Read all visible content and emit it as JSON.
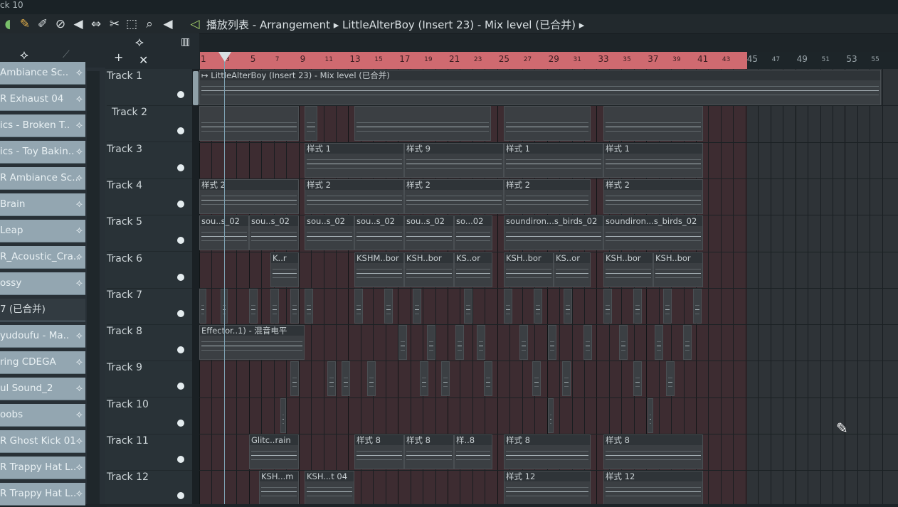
{
  "window": {
    "title_text": "播放列表 - Arrangement ▸ LittleAlterBoy (Insert 23) - Mix level (已合并) ▸",
    "corner_label": "ck 10"
  },
  "toolbar_icons": [
    "pencil-icon",
    "paint-icon",
    "mute-icon",
    "speaker-icon",
    "slip-icon",
    "slice-icon",
    "select-icon",
    "zoom-icon",
    "playback-icon"
  ],
  "browser_items": [
    {
      "label": "Ambiance Sc.."
    },
    {
      "label": "R Exhaust 04"
    },
    {
      "label": "ics - Broken T.."
    },
    {
      "label": "ics - Toy Bakin.."
    },
    {
      "label": "R Ambiance Sc.."
    },
    {
      "label": "Brain"
    },
    {
      "label": "Leap"
    },
    {
      "label": "R_Acoustic_Cra.."
    },
    {
      "label": "ossy"
    },
    {
      "label": "7 (已合并)"
    },
    {
      "label": "yudoufu - Ma.."
    },
    {
      "label": "ring CDEGA"
    },
    {
      "label": "ul Sound_2"
    },
    {
      "label": "oobs"
    },
    {
      "label": "R Ghost Kick 01"
    },
    {
      "label": "R Trappy Hat L.."
    },
    {
      "label": "R Trappy Hat L.."
    }
  ],
  "tracks": [
    "Track 1",
    "Track 2",
    "Track 3",
    "Track 4",
    "Track 5",
    "Track 6",
    "Track 7",
    "Track 8",
    "Track 9",
    "Track 10",
    "Track 11",
    "Track 12"
  ],
  "ruler_ticks": [
    "1",
    "3",
    "5",
    "7",
    "9",
    "11",
    "13",
    "15",
    "17",
    "19",
    "21",
    "23",
    "25",
    "27",
    "29",
    "31",
    "33",
    "35",
    "37",
    "39",
    "41",
    "43",
    "45",
    "47",
    "49",
    "51",
    "53",
    "55"
  ],
  "clips": {
    "t1_audio": "↦ LittleAlterBoy (Insert 23) - Mix level (已合并)",
    "t3_a": "样式 1",
    "t3_b": "样式 9",
    "t3_c": "样式 1",
    "t3_d": "样式 1",
    "t4_a": "样式 2",
    "t4_b": "样式 2",
    "t4_c": "样式 2",
    "t4_d": "样式 2",
    "t4_e": "样式 2",
    "t5_a": "sou..s_02",
    "t5_b": "sou..s_02",
    "t5_c": "sou..s_02",
    "t5_d": "sou..s_02",
    "t5_e": "sou..s_02",
    "t5_f": "so...02",
    "t5_g": "soundiron...s_birds_02",
    "t5_h": "soundiron...s_birds_02",
    "t6_a": "K..r",
    "t6_b": "KSHM..bor",
    "t6_c": "KSH..bor",
    "t6_d": "KS..or",
    "t6_e": "KSH..bor",
    "t6_f": "KS..or",
    "t6_g": "KSH..bor",
    "t6_h": "KSH..bor",
    "t8_auto": "Effector..1) - 混音电平",
    "t11_a": "Glitc..rain",
    "t11_b": "样式 8",
    "t11_c": "样式 8",
    "t11_d": "样..8",
    "t11_e": "样式 8",
    "t11_f": "样式 8",
    "t12_a": "KSH...m",
    "t12_b": "KSH...t 04",
    "t12_c": "样式 12",
    "t12_d": "样式 12"
  },
  "colors": {
    "ruler_selection": "#cf6a70",
    "browser_item": "#93a6b1",
    "grid_hot": "#3d2c31"
  }
}
